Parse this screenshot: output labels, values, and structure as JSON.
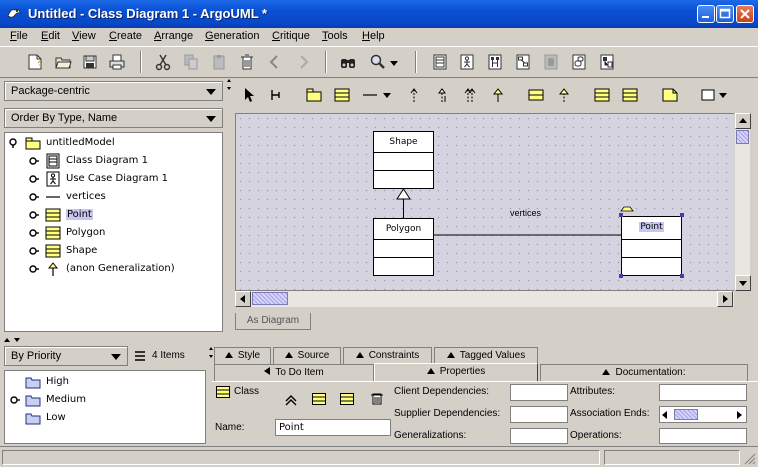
{
  "window": {
    "title": "Untitled - Class Diagram 1 - ArgoUML *"
  },
  "menubar": {
    "items": [
      {
        "label": "File",
        "u": "F",
        "rest": "ile"
      },
      {
        "label": "Edit",
        "u": "E",
        "rest": "dit"
      },
      {
        "label": "View",
        "u": "V",
        "rest": "iew"
      },
      {
        "label": "Create",
        "u": "C",
        "rest": "reate"
      },
      {
        "label": "Arrange",
        "u": "A",
        "rest": "rrange"
      },
      {
        "label": "Generation",
        "u": "G",
        "rest": "eneration"
      },
      {
        "label": "Critique",
        "u": "C",
        "rest": "ritique"
      },
      {
        "label": "Tools",
        "u": "T",
        "rest": "ools"
      },
      {
        "label": "Help",
        "u": "H",
        "rest": "elp"
      }
    ]
  },
  "navigator": {
    "perspective": "Package-centric",
    "order": "Order By Type, Name",
    "tree": [
      {
        "label": "untitledModel",
        "icon": "package-icon",
        "level": 0
      },
      {
        "label": "Class Diagram 1",
        "icon": "class-diagram-icon",
        "level": 1
      },
      {
        "label": "Use Case Diagram 1",
        "icon": "use-case-diagram-icon",
        "level": 1
      },
      {
        "label": "vertices",
        "icon": "association-icon",
        "level": 1
      },
      {
        "label": "Point",
        "icon": "class-icon",
        "level": 1,
        "selected": true
      },
      {
        "label": "Polygon",
        "icon": "class-icon",
        "level": 1
      },
      {
        "label": "Shape",
        "icon": "class-icon",
        "level": 1
      },
      {
        "label": "(anon Generalization)",
        "icon": "generalization-icon",
        "level": 1
      }
    ]
  },
  "diagram": {
    "classes": {
      "shape": "Shape",
      "polygon": "Polygon",
      "point": "Point"
    },
    "association_label": "vertices",
    "tab": "As Diagram"
  },
  "todo": {
    "sort": "By Priority",
    "count": "4 Items",
    "priorities": [
      "High",
      "Medium",
      "Low"
    ]
  },
  "details": {
    "tabs_row1": [
      "Style",
      "Source",
      "Constraints",
      "Tagged Values"
    ],
    "tabs_row2": [
      "To Do Item",
      "Properties",
      "Documentation:"
    ],
    "kind": "Class",
    "name_label": "Name:",
    "name_value": "Point",
    "labels": {
      "client_deps": "Client Dependencies:",
      "supplier_deps": "Supplier Dependencies:",
      "generalizations": "Generalizations:",
      "attributes": "Attributes:",
      "association_ends": "Association Ends:",
      "operations": "Operations:"
    }
  },
  "colors": {
    "titlebar": "#0a4fd3",
    "canvas": "#d6d3e1",
    "class_fill": "#ffff80",
    "selection": "#c6c6f0"
  }
}
